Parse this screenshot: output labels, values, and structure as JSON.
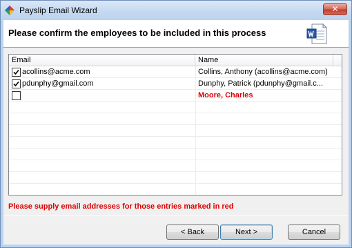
{
  "window": {
    "title": "Payslip Email Wizard",
    "close_label": "✕"
  },
  "header": {
    "heading": "Please confirm the employees to be included in this process"
  },
  "grid": {
    "columns": [
      "Email",
      "Name"
    ],
    "rows": [
      {
        "checked": true,
        "email": "acollins@acme.com",
        "name": "Collins, Anthony (acollins@acme.com)",
        "missing_email": false
      },
      {
        "checked": true,
        "email": "pdunphy@gmail.com",
        "name": "Dunphy, Patrick (pdunphy@gmail.c...",
        "missing_email": false
      },
      {
        "checked": false,
        "email": "",
        "name": "Moore, Charles",
        "missing_email": true
      }
    ]
  },
  "warning": "Please supply email addresses for those entries marked in red",
  "buttons": {
    "back": "< Back",
    "next": "Next >",
    "cancel": "Cancel"
  },
  "colors": {
    "error": "#e00000",
    "titlebar": "#c5d9f1"
  },
  "icons": {
    "app": "app-icon",
    "document": "word-document-icon"
  }
}
